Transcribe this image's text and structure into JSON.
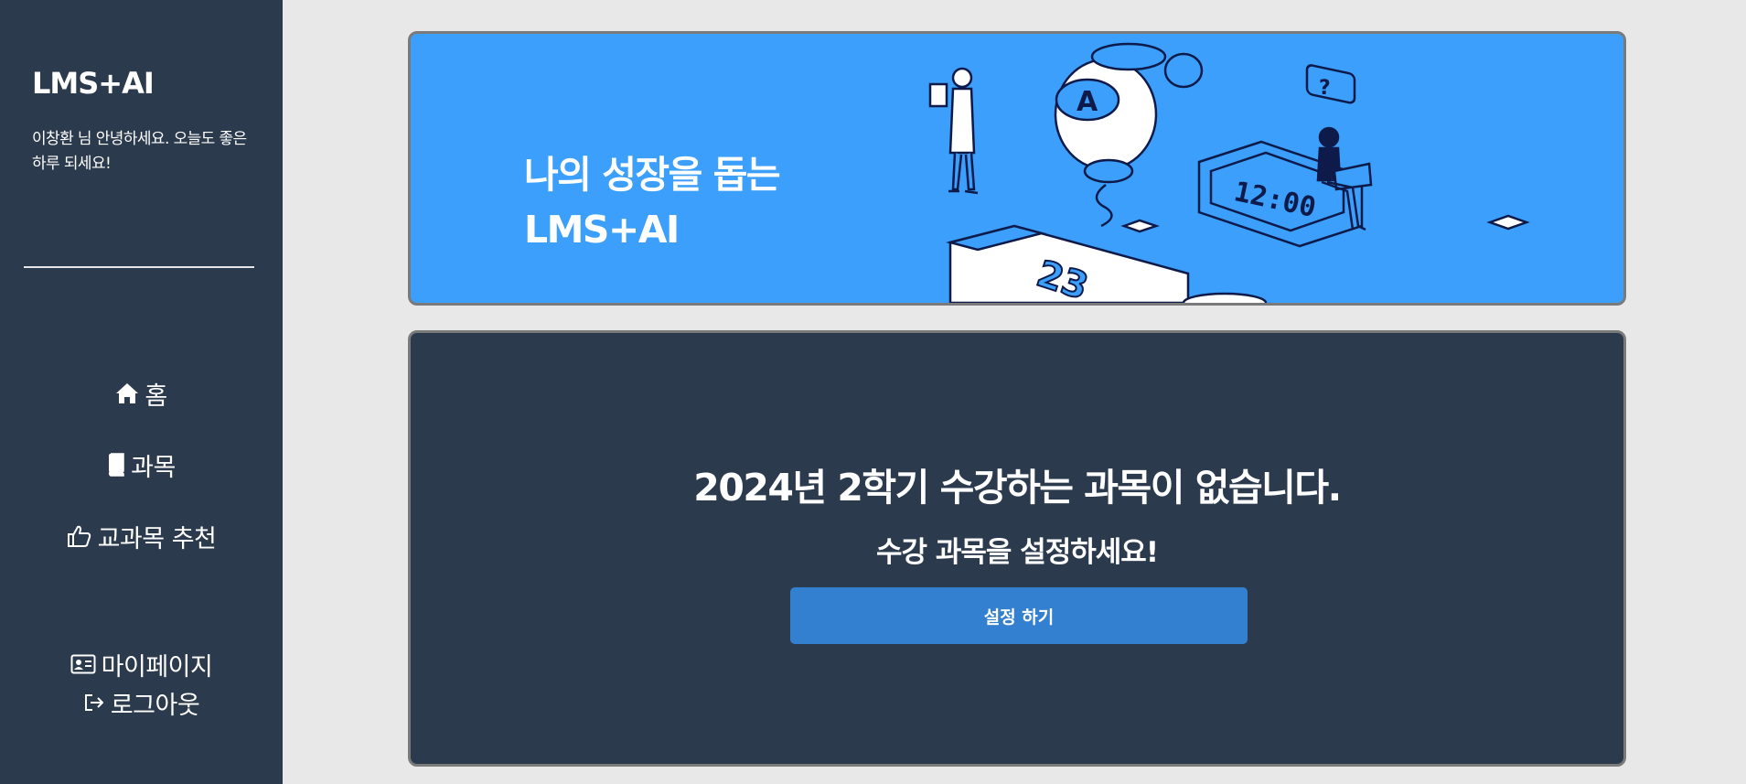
{
  "sidebar": {
    "brand": "LMS+AI",
    "greeting": "이창환 님 안녕하세요. 오늘도 좋은 하루 되세요!",
    "nav": {
      "home": "홈",
      "course": "과목",
      "recommend": "교과목 추천",
      "mypage": "마이페이지",
      "logout": "로그아웃"
    },
    "icons": [
      "home-icon",
      "book-icon",
      "thumbs-up-icon",
      "id-card-icon",
      "logout-icon"
    ]
  },
  "banner": {
    "title_line1": "나의 성장을 돕는",
    "title_line2": "LMS+AI",
    "illustration": {
      "robot_letter": "A",
      "clock_time": "12:00",
      "calendar_day": "23",
      "question_mark": "?"
    },
    "background_color": "#3b9ffb"
  },
  "main": {
    "heading": "2024년 2학기 수강하는 과목이 없습니다.",
    "subheading": "수강 과목을 설정하세요!",
    "setup_button": "설정 하기",
    "button_color": "#3380d0"
  },
  "colors": {
    "sidebar_bg": "#2c3a4d",
    "page_bg": "#e8e8e8",
    "text": "#ffffff"
  }
}
